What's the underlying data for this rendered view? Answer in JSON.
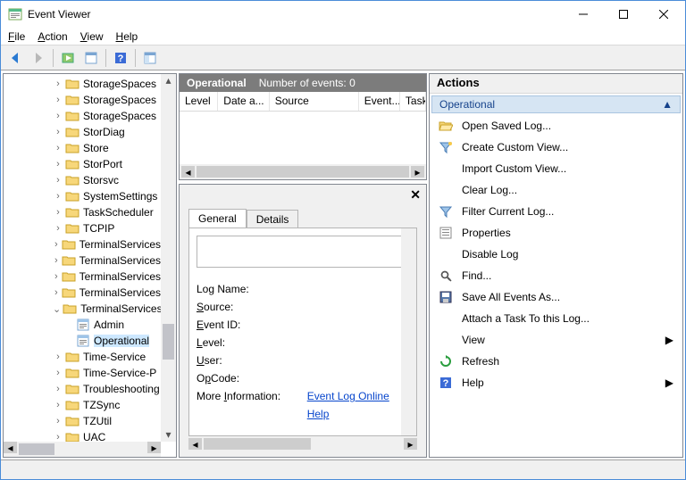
{
  "window": {
    "title": "Event Viewer"
  },
  "menu": {
    "file": "File",
    "action": "Action",
    "view": "View",
    "help": "Help"
  },
  "tree": {
    "items": [
      {
        "label": "StorageSpaces",
        "exp": ">"
      },
      {
        "label": "StorageSpaces",
        "exp": ">"
      },
      {
        "label": "StorageSpaces",
        "exp": ">"
      },
      {
        "label": "StorDiag",
        "exp": ">"
      },
      {
        "label": "Store",
        "exp": ">"
      },
      {
        "label": "StorPort",
        "exp": ">"
      },
      {
        "label": "Storsvc",
        "exp": ">"
      },
      {
        "label": "SystemSettings",
        "exp": ">"
      },
      {
        "label": "TaskScheduler",
        "exp": ">"
      },
      {
        "label": "TCPIP",
        "exp": ">"
      },
      {
        "label": "TerminalServices",
        "exp": ">"
      },
      {
        "label": "TerminalServices",
        "exp": ">"
      },
      {
        "label": "TerminalServices",
        "exp": ">"
      },
      {
        "label": "TerminalServices",
        "exp": ">"
      },
      {
        "label": "TerminalServices",
        "exp": "v",
        "children": [
          {
            "label": "Admin",
            "type": "log"
          },
          {
            "label": "Operational",
            "type": "log",
            "selected": true
          }
        ]
      },
      {
        "label": "Time-Service",
        "exp": ">"
      },
      {
        "label": "Time-Service-P",
        "exp": ">"
      },
      {
        "label": "Troubleshooting",
        "exp": ">"
      },
      {
        "label": "TZSync",
        "exp": ">"
      },
      {
        "label": "TZUtil",
        "exp": ">"
      },
      {
        "label": "UAC",
        "exp": ">"
      }
    ]
  },
  "center": {
    "header_name": "Operational",
    "header_count": "Number of events: 0",
    "columns": [
      "Level",
      "Date a...",
      "Source",
      "Event...",
      "Task"
    ]
  },
  "detail": {
    "tab_general": "General",
    "tab_details": "Details",
    "log_name": "Log Name:",
    "source": "Source:",
    "event_id": "Event ID:",
    "level": "Level:",
    "user": "User:",
    "opcode": "OpCode:",
    "more_info": "More Information:",
    "help_link": "Event Log Online Help"
  },
  "actions": {
    "title": "Actions",
    "section": "Operational",
    "items": [
      {
        "label": "Open Saved Log...",
        "icon": "folder-open"
      },
      {
        "label": "Create Custom View...",
        "icon": "funnel-sparkle"
      },
      {
        "label": "Import Custom View...",
        "icon": ""
      },
      {
        "label": "Clear Log...",
        "icon": ""
      },
      {
        "label": "Filter Current Log...",
        "icon": "funnel"
      },
      {
        "label": "Properties",
        "icon": "properties"
      },
      {
        "label": "Disable Log",
        "icon": ""
      },
      {
        "label": "Find...",
        "icon": "find"
      },
      {
        "label": "Save All Events As...",
        "icon": "save"
      },
      {
        "label": "Attach a Task To this Log...",
        "icon": ""
      },
      {
        "label": "View",
        "icon": "",
        "submenu": true
      },
      {
        "label": "Refresh",
        "icon": "refresh"
      },
      {
        "label": "Help",
        "icon": "help",
        "submenu": true
      }
    ]
  }
}
